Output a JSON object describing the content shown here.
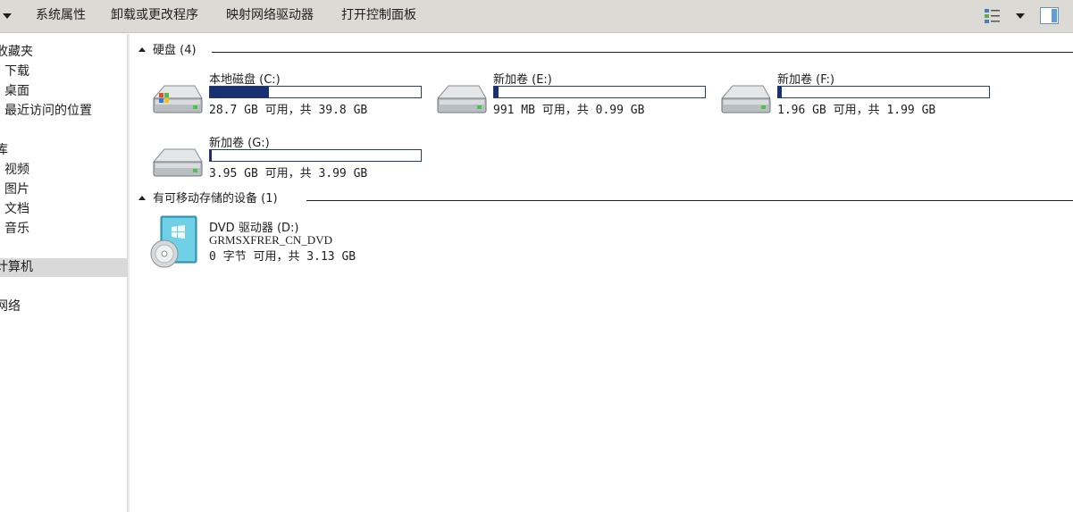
{
  "toolbar": {
    "items": [
      "系统属性",
      "卸载或更改程序",
      "映射网络驱动器",
      "打开控制面板"
    ]
  },
  "nav": {
    "items": [
      {
        "label": "收藏夹"
      },
      {
        "label": "下载"
      },
      {
        "label": "桌面"
      },
      {
        "label": "最近访问的位置"
      },
      {
        "label": "库"
      },
      {
        "label": "视频"
      },
      {
        "label": "图片"
      },
      {
        "label": "文档"
      },
      {
        "label": "音乐"
      },
      {
        "label": "计算机",
        "selected": true
      },
      {
        "label": "网络"
      }
    ]
  },
  "groups": {
    "hard_disks": "硬盘 (4)",
    "removable": "有可移动存储的设备 (1)"
  },
  "drives": [
    {
      "name": "本地磁盘 (C:)",
      "info": "28.7 GB 可用，共 39.8 GB",
      "used_fraction": 0.279
    },
    {
      "name": "新加卷 (E:)",
      "info": "991 MB 可用，共 0.99 GB",
      "used_fraction": 0.02
    },
    {
      "name": "新加卷 (F:)",
      "info": "1.96 GB 可用，共 1.99 GB",
      "used_fraction": 0.015
    },
    {
      "name": "新加卷 (G:)",
      "info": "3.95 GB 可用，共 3.99 GB",
      "used_fraction": 0.01
    }
  ],
  "dvd": {
    "name": "DVD 驱动器 (D:)",
    "label": "GRMSXFRER_CN_DVD",
    "info": "0 字节 可用，共 3.13 GB"
  },
  "colors": {
    "toolbar_bg": "#dcdad5",
    "bar_fill": "#163070",
    "selected_bg": "#d9d9d9"
  }
}
